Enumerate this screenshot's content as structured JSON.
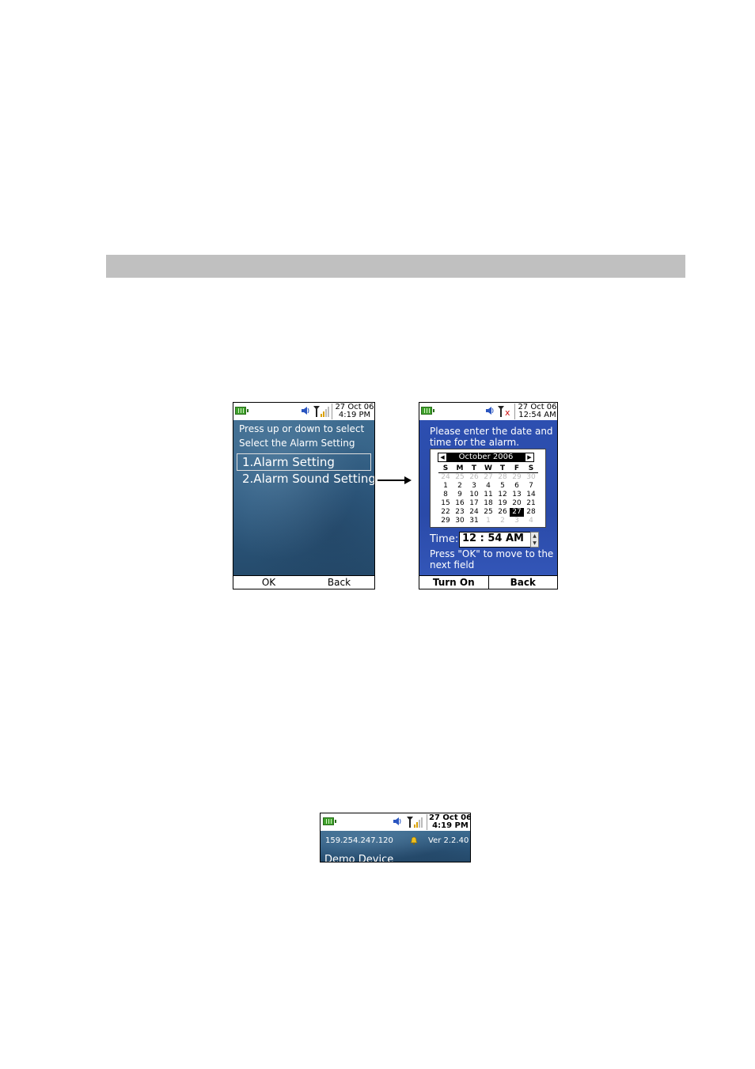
{
  "phone1": {
    "date": "27 Oct 06",
    "time": "4:19 PM",
    "line1": "Press up or down to select",
    "line2": "Select the Alarm Setting",
    "menu": [
      "1.Alarm Setting",
      "2.Alarm Sound Setting"
    ],
    "softkeys": [
      "OK",
      "Back"
    ]
  },
  "phone2": {
    "date": "27 Oct 06",
    "time": "12:54 AM",
    "prompt1": "Please enter the date and",
    "prompt2": "time for the alarm.",
    "calendar": {
      "month": "October 2006",
      "days_of_week": [
        "S",
        "M",
        "T",
        "W",
        "T",
        "F",
        "S"
      ],
      "weeks": [
        [
          "24",
          "25",
          "26",
          "27",
          "28",
          "29",
          "30"
        ],
        [
          "1",
          "2",
          "3",
          "4",
          "5",
          "6",
          "7"
        ],
        [
          "8",
          "9",
          "10",
          "11",
          "12",
          "13",
          "14"
        ],
        [
          "15",
          "16",
          "17",
          "18",
          "19",
          "20",
          "21"
        ],
        [
          "22",
          "23",
          "24",
          "25",
          "26",
          "27",
          "28"
        ],
        [
          "29",
          "30",
          "31",
          "1",
          "2",
          "3",
          "4"
        ]
      ],
      "selected_day": "27"
    },
    "time_label": "Time:",
    "time_value": "12 : 54 AM",
    "hint1": "Press \"OK\" to move to the",
    "hint2": "next field",
    "softkeys": [
      "Turn On",
      "Back"
    ]
  },
  "phone3": {
    "date": "27 Oct 06",
    "time": "4:19 PM",
    "ip": "159.254.247.120",
    "version": "Ver 2.2.40",
    "device_name": "Demo Device"
  },
  "colors": {
    "section_bar": "#c0c0c0",
    "sea_blue": "#2e5a80",
    "royal_blue": "#2a4aa8",
    "battery_green": "#3fa02c"
  },
  "icons": [
    "battery-icon",
    "speaker-icon",
    "antenna-icon",
    "signal-bars-icon",
    "no-signal-x-icon",
    "alarm-bell-icon",
    "arrow-right-icon"
  ]
}
